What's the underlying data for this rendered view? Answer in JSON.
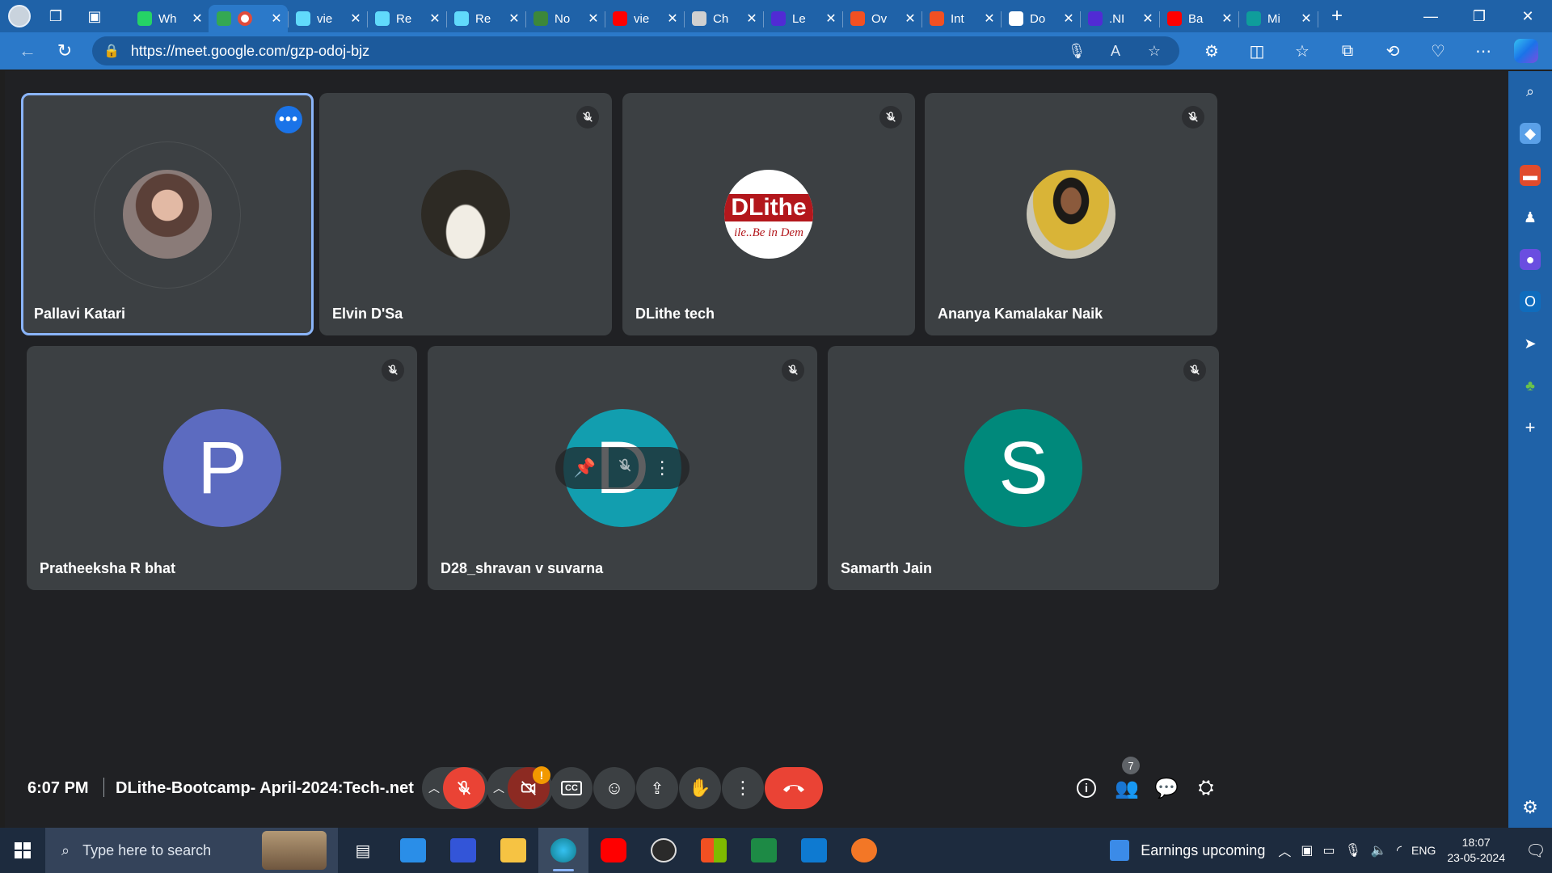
{
  "browser": {
    "tabs": [
      {
        "title": "Wh",
        "favicon_color": "#25d366",
        "icon": "whatsapp-icon"
      },
      {
        "title": "",
        "favicon_color": "#34a853",
        "icon": "google-meet-icon",
        "recording": true,
        "active": true
      },
      {
        "title": "vie",
        "favicon_color": "#61dafb",
        "icon": "react-icon"
      },
      {
        "title": "Re",
        "favicon_color": "#61dafb",
        "icon": "react-icon"
      },
      {
        "title": "Re",
        "favicon_color": "#61dafb",
        "icon": "react-icon"
      },
      {
        "title": "No",
        "favicon_color": "#3c873a",
        "icon": "nodejs-icon"
      },
      {
        "title": "vie",
        "favicon_color": "#ff0000",
        "icon": "youtube-icon"
      },
      {
        "title": "Ch",
        "favicon_color": "#d0d0d0",
        "icon": "chatgpt-icon"
      },
      {
        "title": "Le",
        "favicon_color": "#512bd4",
        "icon": "dotnet-icon"
      },
      {
        "title": "Ov",
        "favicon_color": "#f25022",
        "icon": "microsoft-icon"
      },
      {
        "title": "Int",
        "favicon_color": "#f25022",
        "icon": "microsoft-icon"
      },
      {
        "title": "Do",
        "favicon_color": "#ffffff",
        "icon": "document-icon"
      },
      {
        "title": ".NI",
        "favicon_color": "#512bd4",
        "icon": "dotnet-icon"
      },
      {
        "title": "Ba",
        "favicon_color": "#ff0000",
        "icon": "youtube-icon"
      },
      {
        "title": "Mi",
        "favicon_color": "#0f9d9b",
        "icon": "edge-icon"
      }
    ],
    "url": "https://meet.google.com/gzp-odoj-bjz"
  },
  "participants": {
    "row1": [
      {
        "name": "Pallavi Katari",
        "avatar": "photo",
        "avatar_color": "#8a6b5e",
        "speaking": true,
        "muted": false
      },
      {
        "name": "Elvin D'Sa",
        "avatar": "photo",
        "avatar_color": "#2d2a24",
        "muted": true
      },
      {
        "name": "DLithe tech",
        "avatar": "logo",
        "logo_text": "DLithe",
        "logo_sub": "ile..Be in Dem",
        "muted": true
      },
      {
        "name": "Ananya Kamalakar Naik",
        "avatar": "photo",
        "avatar_color": "#c9a12b",
        "muted": true
      }
    ],
    "row2": [
      {
        "name": "Pratheeksha R bhat",
        "initial": "P",
        "avatar_color": "#5c6bc0",
        "muted": true
      },
      {
        "name": "D28_shravan v suvarna",
        "initial": "D",
        "avatar_color": "#129eaf",
        "muted": true,
        "hovered": true
      },
      {
        "name": "Samarth Jain",
        "initial": "S",
        "avatar_color": "#00897b",
        "muted": true
      }
    ]
  },
  "meeting": {
    "time": "6:07 PM",
    "title": "DLithe-Bootcamp- April-2024:Tech-.net",
    "people_count": "7",
    "camera_warning": "!"
  },
  "taskbar": {
    "search_placeholder": "Type here to search",
    "news": "Earnings upcoming",
    "language": "ENG",
    "time": "18:07",
    "date": "23-05-2024"
  }
}
